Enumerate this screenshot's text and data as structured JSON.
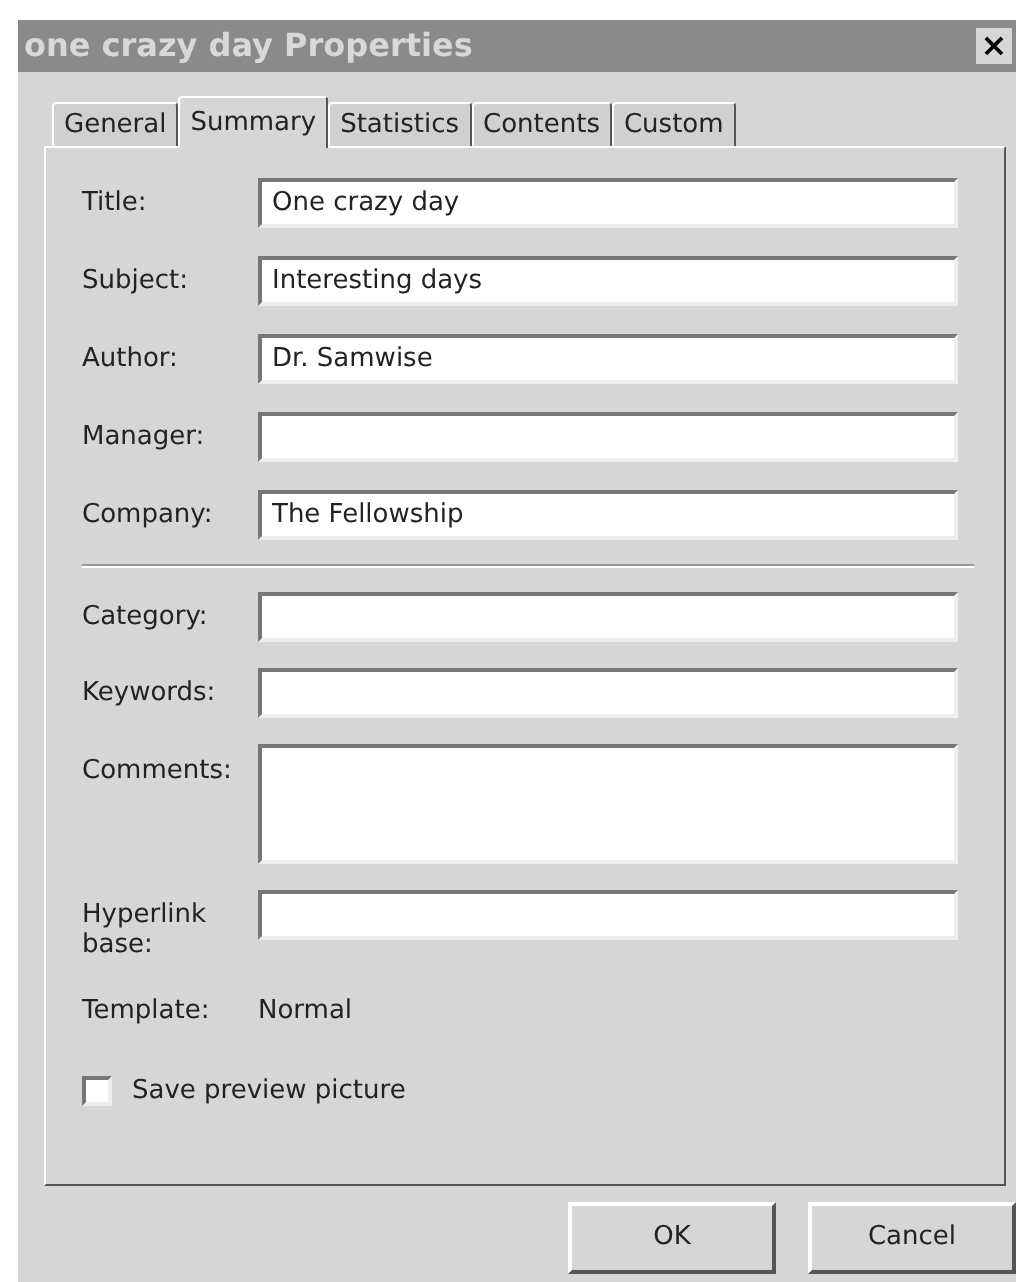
{
  "window": {
    "title": "one crazy day Properties",
    "close": "×"
  },
  "tabs": [
    {
      "label": "General",
      "selected": false
    },
    {
      "label": "Summary",
      "selected": true
    },
    {
      "label": "Statistics",
      "selected": false
    },
    {
      "label": "Contents",
      "selected": false
    },
    {
      "label": "Custom",
      "selected": false
    }
  ],
  "field_groups": [
    [
      {
        "label": "Title:",
        "kind": "text",
        "value": "One crazy day"
      },
      {
        "label": "Subject:",
        "kind": "text",
        "value": "Interesting days"
      },
      {
        "label": "Author:",
        "kind": "text",
        "value": "Dr. Samwise"
      },
      {
        "label": "Manager:",
        "kind": "text"
      },
      {
        "label": "Company:",
        "kind": "text",
        "value": "The Fellowship"
      }
    ],
    [
      {
        "label": "Category:",
        "kind": "text"
      },
      {
        "label": "Keywords:",
        "kind": "text"
      },
      {
        "label": "Comments:",
        "kind": "multiline"
      },
      {
        "label": "Hyperlink base:",
        "kind": "text"
      }
    ]
  ],
  "template": {
    "label": "Template:",
    "value": "Normal"
  },
  "save_preview": {
    "label": "Save preview picture",
    "checked": false
  },
  "buttons": [
    "OK",
    "Cancel"
  ]
}
